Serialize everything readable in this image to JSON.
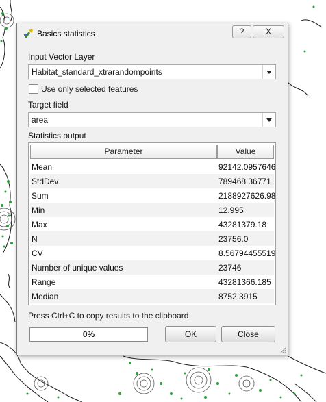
{
  "dialog": {
    "title": "Basics statistics",
    "help_label": "?",
    "close_label": "X",
    "input_layer_label": "Input Vector Layer",
    "input_layer_value": "Habitat_standard_xtrarandompoints",
    "selected_only_label": "Use only selected features",
    "selected_only_checked": false,
    "target_field_label": "Target field",
    "target_field_value": "area",
    "stats_output_label": "Statistics output",
    "table": {
      "headers": [
        "Parameter",
        "Value"
      ],
      "rows": [
        {
          "parameter": "Mean",
          "value": "92142.0957646"
        },
        {
          "parameter": "StdDev",
          "value": "789468.36771"
        },
        {
          "parameter": "Sum",
          "value": "2188927626.98"
        },
        {
          "parameter": "Min",
          "value": "12.995"
        },
        {
          "parameter": "Max",
          "value": "43281379.18"
        },
        {
          "parameter": "N",
          "value": "23756.0"
        },
        {
          "parameter": "CV",
          "value": "8.56794455519"
        },
        {
          "parameter": "Number of unique values",
          "value": "23746"
        },
        {
          "parameter": "Range",
          "value": "43281366.185"
        },
        {
          "parameter": "Median",
          "value": "8752.3915"
        }
      ]
    },
    "copy_hint": "Press Ctrl+C to copy results to the clipboard",
    "progress_text": "0%",
    "progress_fraction": 0,
    "ok_label": "OK",
    "close_button_label": "Close"
  },
  "colors": {
    "map_green": "#2e9e3a",
    "map_outline": "#1a1a1a",
    "dialog_bg": "#f0f0f0",
    "row_alt": "#f2f2f2"
  },
  "icons": {
    "app": "qgis-tool-icon",
    "grip": "resize-grip-icon"
  }
}
